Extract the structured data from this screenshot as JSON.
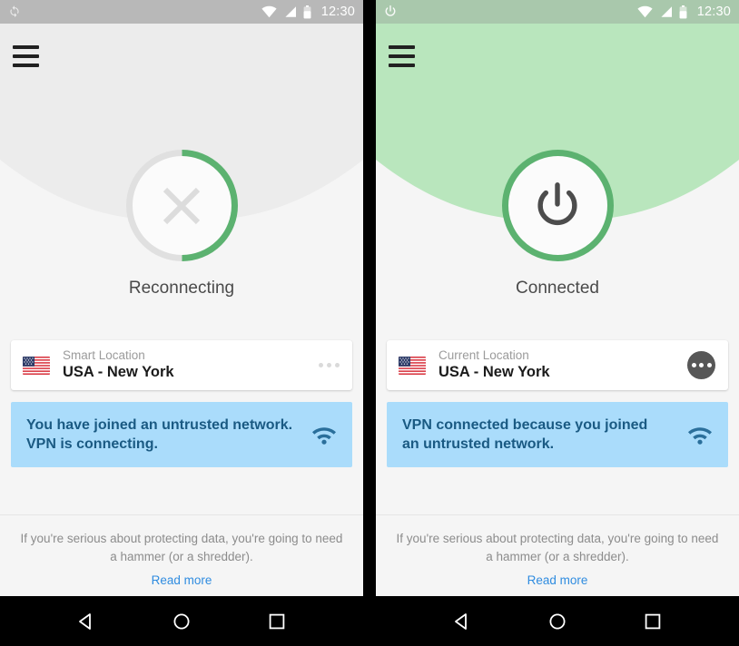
{
  "colors": {
    "green_accent": "#5cb270",
    "green_header": "#b9e6bd",
    "statusbar_grey": "#b8b8b8",
    "statusbar_green": "#a9c8ac",
    "banner_bg": "#aadcfb",
    "banner_text": "#1a5a83",
    "link_blue": "#2f8ce0",
    "page_bg": "#f5f5f5",
    "hero_grey": "#ececec"
  },
  "screens": [
    {
      "id": "reconnecting",
      "statusbar": {
        "left_icon": "sync-icon",
        "wifi_icon": "wifi-icon",
        "signal_icon": "signal-icon",
        "battery_icon": "battery-icon",
        "time": "12:30"
      },
      "menu_icon": "hamburger-menu-icon",
      "dial": {
        "glyph": "close-x-icon",
        "state_label": "Reconnecting",
        "progress_percent": 50,
        "ring_color": "#5cb270",
        "track_color": "#e0e0e0"
      },
      "location_card": {
        "flag_icon": "usa-flag-icon",
        "kicker": "Smart Location",
        "name": "USA - New York",
        "menu_icon": "more-options-icon",
        "menu_style": "flat"
      },
      "banner": {
        "text": "You have joined an untrusted network.\nVPN is connecting.",
        "icon": "wifi-icon"
      },
      "footer": {
        "tagline": "If you're serious about protecting data, you're going to need a hammer (or a shredder).",
        "link": "Read more"
      },
      "navbar": {
        "back": "back-triangle-icon",
        "home": "home-circle-icon",
        "recents": "recents-square-icon"
      }
    },
    {
      "id": "connected",
      "statusbar": {
        "left_icon": "power-icon",
        "wifi_icon": "wifi-icon",
        "signal_icon": "signal-icon",
        "battery_icon": "battery-icon",
        "time": "12:30"
      },
      "menu_icon": "hamburger-menu-icon",
      "dial": {
        "glyph": "power-icon",
        "state_label": "Connected",
        "progress_percent": 100,
        "ring_color": "#5cb270",
        "track_color": "#5cb270"
      },
      "location_card": {
        "flag_icon": "usa-flag-icon",
        "kicker": "Current Location",
        "name": "USA - New York",
        "menu_icon": "more-options-icon",
        "menu_style": "round"
      },
      "banner": {
        "text": "VPN connected because you joined\nan untrusted network.",
        "icon": "wifi-icon"
      },
      "footer": {
        "tagline": "If you're serious about protecting data, you're going to need a hammer (or a shredder).",
        "link": "Read more"
      },
      "navbar": {
        "back": "back-triangle-icon",
        "home": "home-circle-icon",
        "recents": "recents-square-icon"
      }
    }
  ]
}
